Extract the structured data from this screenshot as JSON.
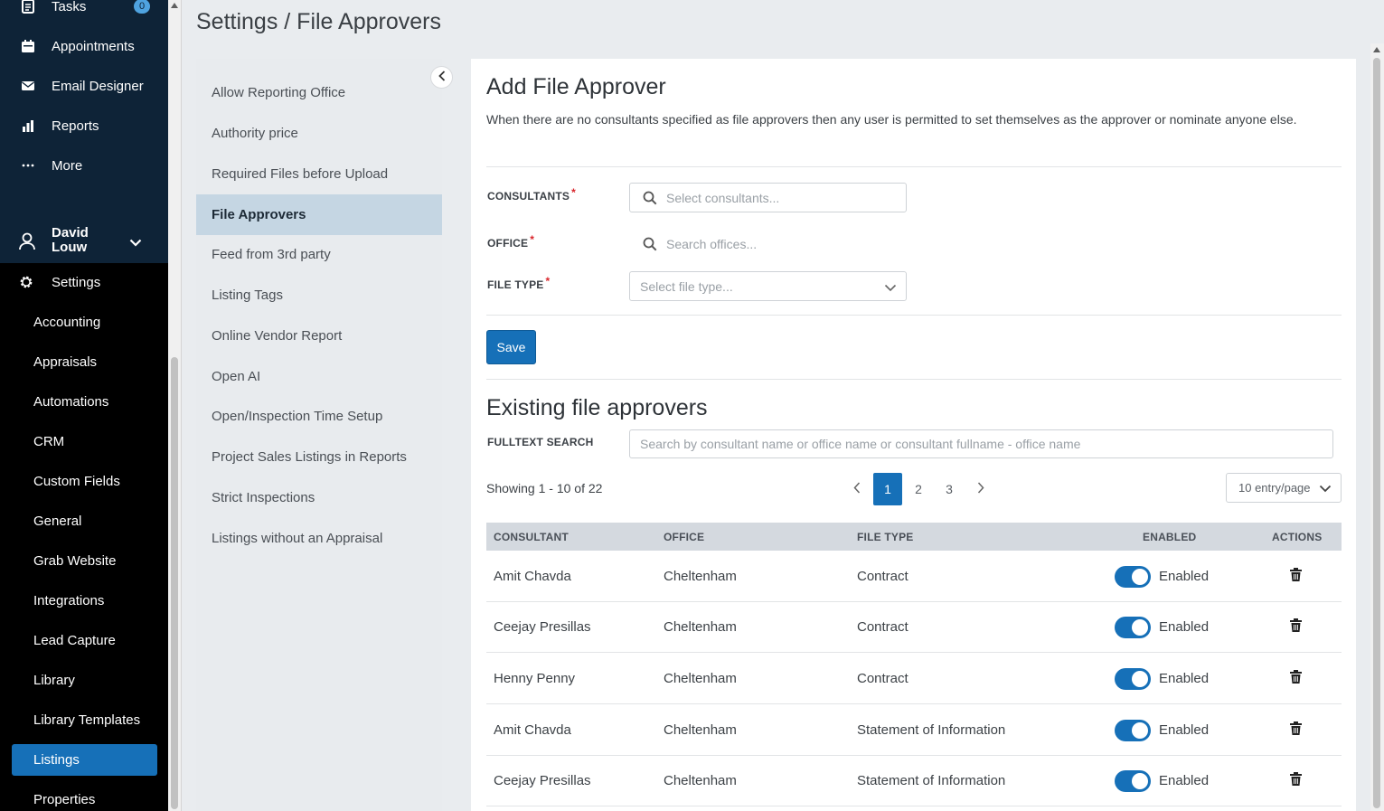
{
  "nav": {
    "top_items": [
      {
        "label": "Tasks",
        "icon": "tasks-icon",
        "badge": "0"
      },
      {
        "label": "Appointments",
        "icon": "calendar-icon"
      },
      {
        "label": "Email Designer",
        "icon": "envelope-icon"
      },
      {
        "label": "Reports",
        "icon": "bar-chart-icon"
      },
      {
        "label": "More",
        "icon": "ellipsis-icon"
      }
    ],
    "user_name": "David Louw",
    "settings_label": "Settings",
    "settings_items": [
      "Accounting",
      "Appraisals",
      "Automations",
      "CRM",
      "Custom Fields",
      "General",
      "Grab Website",
      "Integrations",
      "Lead Capture",
      "Library",
      "Library Templates",
      "Listings",
      "Properties"
    ],
    "active_settings_item": "Listings"
  },
  "page_title": "Settings / File Approvers",
  "submenu": {
    "items": [
      "Allow Reporting Office",
      "Authority price",
      "Required Files before Upload",
      "File Approvers",
      "Feed from 3rd party",
      "Listing Tags",
      "Online Vendor Report",
      "Open AI",
      "Open/Inspection Time Setup",
      "Project Sales Listings in Reports",
      "Strict Inspections",
      "Listings without an Appraisal"
    ],
    "active": "File Approvers"
  },
  "form": {
    "title": "Add File Approver",
    "intro": "When there are no consultants specified as file approvers then any user is permitted to set themselves as the approver or nominate anyone else.",
    "consultants_label": "CONSULTANTS",
    "consultants_placeholder": "Select consultants...",
    "office_label": "OFFICE",
    "office_placeholder": "Search offices...",
    "file_type_label": "FILE TYPE",
    "file_type_placeholder": "Select file type...",
    "required_mark": "*",
    "save_label": "Save"
  },
  "existing": {
    "title": "Existing file approvers",
    "search_label": "FULLTEXT SEARCH",
    "search_placeholder": "Search by consultant name or office name or consultant fullname - office name",
    "showing": "Showing 1 - 10 of 22",
    "pages": [
      "1",
      "2",
      "3"
    ],
    "active_page": "1",
    "per_page": "10 entry/page",
    "columns": [
      "CONSULTANT",
      "OFFICE",
      "FILE TYPE",
      "ENABLED",
      "ACTIONS"
    ],
    "rows": [
      {
        "consultant": "Amit Chavda",
        "office": "Cheltenham",
        "file_type": "Contract",
        "enabled": "Enabled"
      },
      {
        "consultant": "Ceejay Presillas",
        "office": "Cheltenham",
        "file_type": "Contract",
        "enabled": "Enabled"
      },
      {
        "consultant": "Henny Penny",
        "office": "Cheltenham",
        "file_type": "Contract",
        "enabled": "Enabled"
      },
      {
        "consultant": "Amit Chavda",
        "office": "Cheltenham",
        "file_type": "Statement of Information",
        "enabled": "Enabled"
      },
      {
        "consultant": "Ceejay Presillas",
        "office": "Cheltenham",
        "file_type": "Statement of Information",
        "enabled": "Enabled"
      }
    ]
  },
  "colors": {
    "nav_top_bg": "#0e2337",
    "nav_bottom_bg": "#000000",
    "accent": "#1670b8",
    "submenu_active_bg": "#c5d6e3",
    "table_header_bg": "#d4d9df",
    "required": "#d9262c"
  }
}
